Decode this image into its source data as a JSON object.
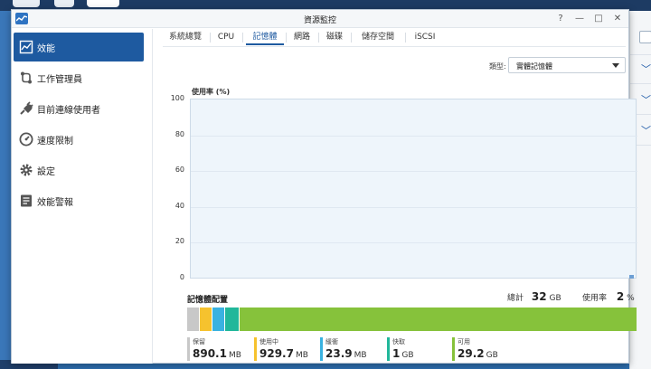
{
  "window": {
    "title": "資源監控",
    "controls": [
      "?",
      "—",
      "□",
      "✕"
    ]
  },
  "sidebar": {
    "items": [
      {
        "label": "效能",
        "icon": "chart-icon",
        "active": true
      },
      {
        "label": "工作管理員",
        "icon": "task-manager-icon",
        "active": false
      },
      {
        "label": "目前連線使用者",
        "icon": "plug-icon",
        "active": false
      },
      {
        "label": "速度限制",
        "icon": "speedometer-icon",
        "active": false
      },
      {
        "label": "設定",
        "icon": "gear-icon",
        "active": false
      },
      {
        "label": "效能警報",
        "icon": "list-icon",
        "active": false
      }
    ]
  },
  "tabs": [
    {
      "label": "系統總覽",
      "active": false
    },
    {
      "label": "CPU",
      "active": false
    },
    {
      "label": "記憶體",
      "active": true
    },
    {
      "label": "網路",
      "active": false
    },
    {
      "label": "磁碟",
      "active": false
    },
    {
      "label": "儲存空間",
      "active": false
    },
    {
      "label": "iSCSI",
      "active": false
    }
  ],
  "type_filter": {
    "label": "類型:",
    "value": "實體記憶體"
  },
  "chart_data": {
    "type": "area",
    "ylabel": "使用率 (%)",
    "ylim": [
      0,
      100
    ],
    "yticks": [
      "100",
      "80",
      "60",
      "40",
      "20",
      "0"
    ],
    "grid": true,
    "series": [
      {
        "values": [
          2
        ]
      }
    ]
  },
  "allocation": {
    "title": "記憶體配置",
    "total_label": "總計",
    "total_value": "32",
    "total_unit": "GB",
    "usage_label": "使用率",
    "usage_value": "2",
    "usage_unit": "%",
    "segments": [
      {
        "name": "保留",
        "value": "890.1",
        "unit": "MB",
        "gb": 0.87,
        "color": "#c8c8c8"
      },
      {
        "name": "使用中",
        "value": "929.7",
        "unit": "MB",
        "gb": 0.91,
        "color": "#f6c22e"
      },
      {
        "name": "緩衝",
        "value": "23.9",
        "unit": "MB",
        "gb": 0.023,
        "color": "#3ab2e0"
      },
      {
        "name": "快取",
        "value": "1",
        "unit": "GB",
        "gb": 1.0,
        "color": "#21b79a"
      },
      {
        "name": "可用",
        "value": "29.2",
        "unit": "GB",
        "gb": 29.2,
        "color": "#86c23b"
      }
    ]
  }
}
